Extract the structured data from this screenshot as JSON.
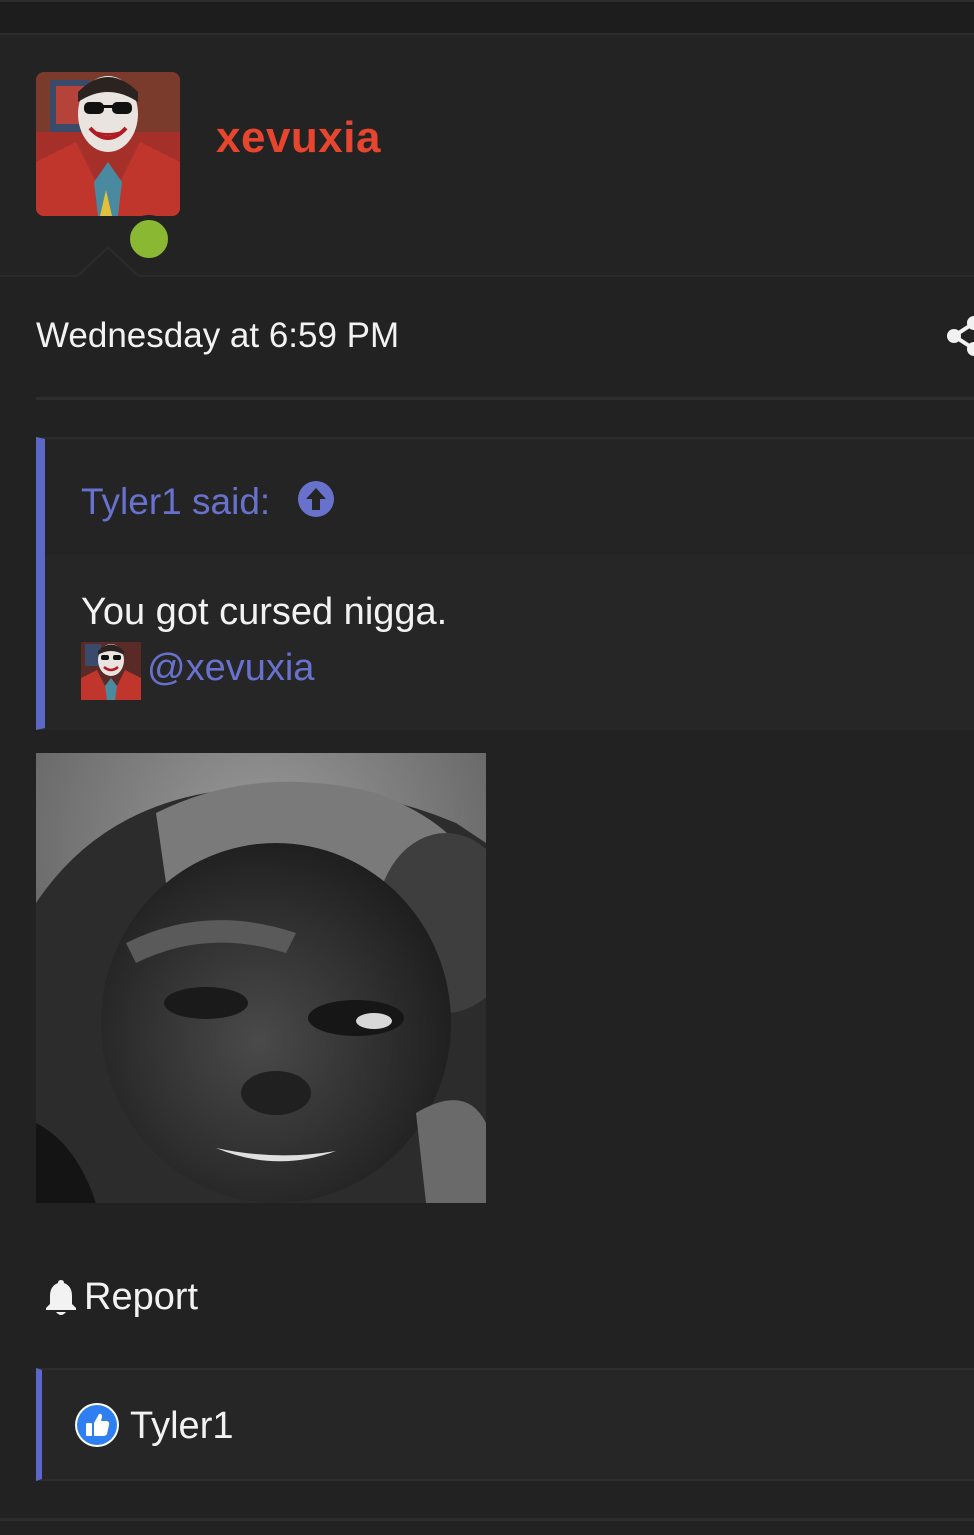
{
  "post": {
    "author": {
      "username": "xevuxia",
      "avatar_icon": "joker-avatar",
      "status": "online",
      "status_color": "#8ab833",
      "username_color": "#e8452e"
    },
    "timestamp": "Wednesday at 6:59 PM",
    "share_icon": "share-icon",
    "quote": {
      "author_label": "Tyler1 said:",
      "jump_icon": "arrow-up-circle-icon",
      "text": "You got cursed nigga.",
      "mention": "@xevuxia",
      "accent_color": "#5c68c8"
    },
    "image": {
      "description_icon": "post-image"
    },
    "actions": {
      "report_label": "Report",
      "report_icon": "bell-icon"
    },
    "reactions": {
      "icon": "like-icon",
      "users": "Tyler1"
    }
  }
}
